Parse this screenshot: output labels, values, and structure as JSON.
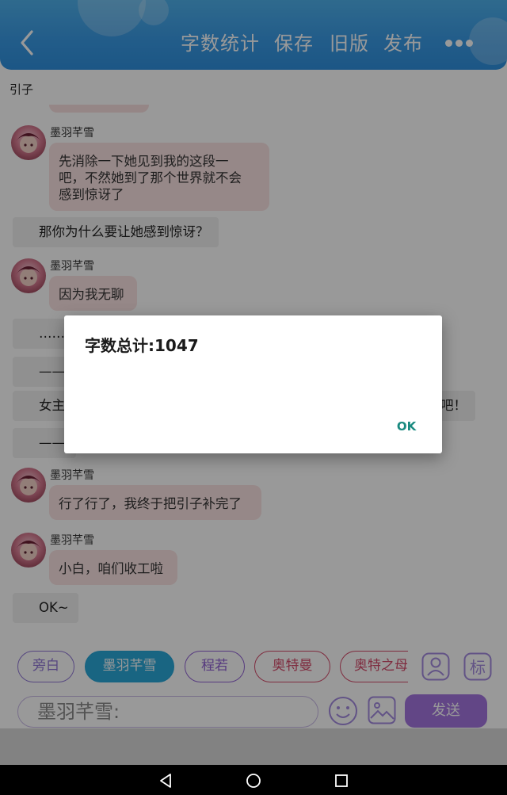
{
  "header": {
    "actions": [
      {
        "label": "字数统计"
      },
      {
        "label": "保存"
      },
      {
        "label": "旧版"
      },
      {
        "label": "发布"
      }
    ]
  },
  "chapter": {
    "title": "引子"
  },
  "messages": [
    {
      "kind": "character",
      "sender": "墨羽芊雪",
      "lines": [
        "先消除一下她见到我的这段一",
        "吧，不然她到了那个世界就不会",
        "感到惊讶了"
      ]
    },
    {
      "kind": "narration",
      "text": "那你为什么要让她感到惊讶？"
    },
    {
      "kind": "character",
      "sender": "墨羽芊雪",
      "lines": [
        "因为我无聊"
      ]
    },
    {
      "kind": "narration",
      "text": "……我"
    },
    {
      "kind": "narration",
      "text": "——"
    },
    {
      "kind": "narration",
      "text": "女主",
      "tail": "吧！"
    },
    {
      "kind": "narration",
      "text": "——"
    },
    {
      "kind": "character",
      "sender": "墨羽芊雪",
      "lines": [
        "行了行了，我终于把引子补完了"
      ]
    },
    {
      "kind": "character",
      "sender": "墨羽芊雪",
      "lines": [
        "小白，咱们收工啦"
      ]
    },
    {
      "kind": "narration",
      "text": "OK~"
    }
  ],
  "roles": [
    {
      "label": "旁白",
      "color": "#8f76d6",
      "selected": false
    },
    {
      "label": "墨羽芊雪",
      "color": "#25a5d8",
      "selected": true
    },
    {
      "label": "程若",
      "color": "#8f5fd4",
      "selected": false
    },
    {
      "label": "奥特曼",
      "color": "#d44a6a",
      "selected": false
    },
    {
      "label": "奥特之母",
      "color": "#d44a6a",
      "selected": false
    }
  ],
  "composer": {
    "placeholder": "墨羽芊雪:"
  },
  "send": {
    "label": "发送"
  },
  "tools": {
    "tag_label": "标"
  },
  "dialog": {
    "message": "字数总计:1047",
    "ok_label": "OK"
  },
  "colors": {
    "header": "#3a9be6",
    "bubble": "#fbe3e3",
    "accent": "#a376e0",
    "dialog_button": "#1a8a80"
  }
}
